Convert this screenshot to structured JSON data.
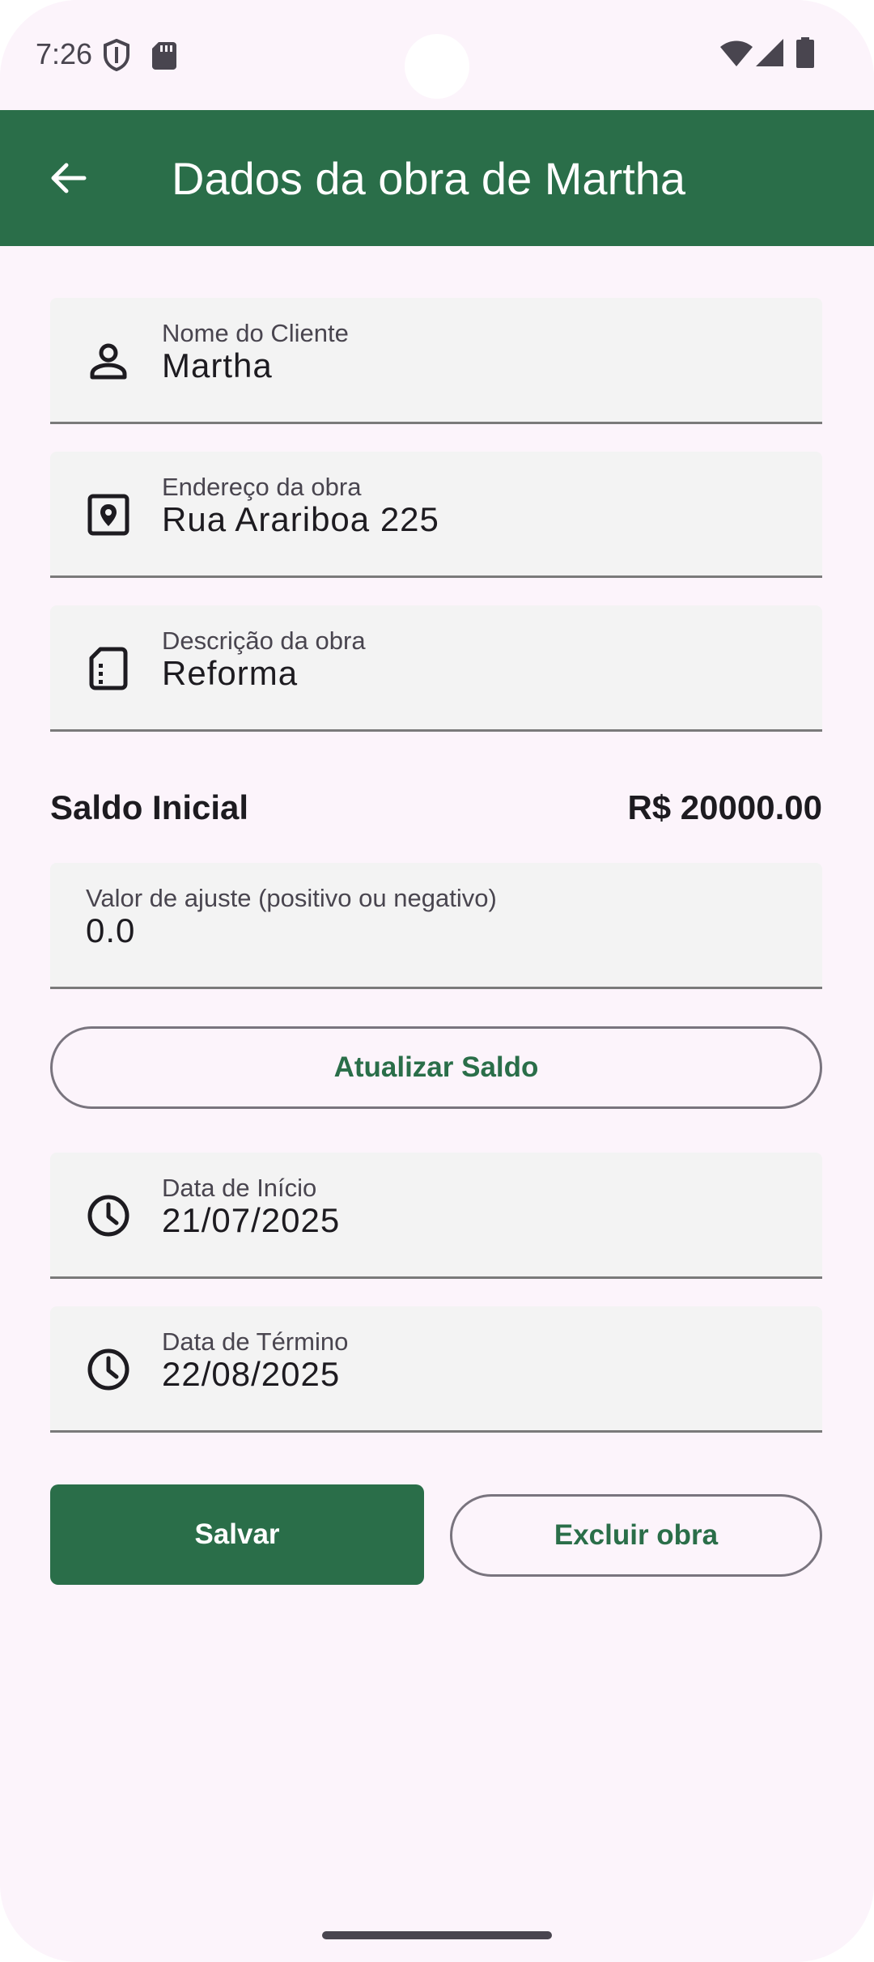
{
  "status_bar": {
    "time": "7:26"
  },
  "app_bar": {
    "title": "Dados da obra de Martha",
    "back_icon": "arrow-back-icon"
  },
  "form": {
    "cliente": {
      "label": "Nome do Cliente",
      "value": "Martha",
      "icon": "person-icon"
    },
    "endereco": {
      "label": "Endereço da obra",
      "value": "Rua Arariboa 225",
      "icon": "location-pin-icon"
    },
    "descricao": {
      "label": "Descrição da obra",
      "value": "Reforma",
      "icon": "document-icon"
    },
    "saldo": {
      "label": "Saldo Inicial",
      "value": "R$ 20000.00"
    },
    "ajuste": {
      "label": "Valor de ajuste (positivo ou negativo)",
      "value": "0.0"
    },
    "atualizar_label": "Atualizar Saldo",
    "inicio": {
      "label": "Data de Início",
      "value": "21/07/2025",
      "icon": "clock-icon"
    },
    "termino": {
      "label": "Data de Término",
      "value": "22/08/2025",
      "icon": "clock-icon"
    },
    "salvar_label": "Salvar",
    "excluir_label": "Excluir obra"
  },
  "colors": {
    "primary": "#2a6e49",
    "background": "#fcf4fb",
    "field_background": "#f3f3f3"
  }
}
